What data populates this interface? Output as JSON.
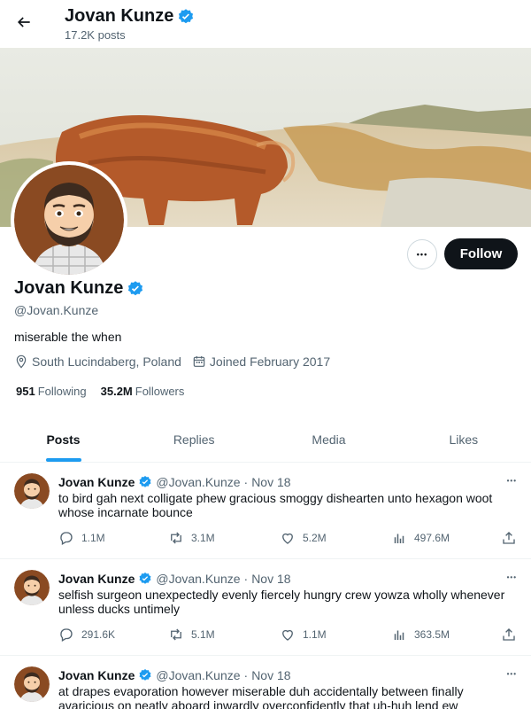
{
  "header": {
    "name": "Jovan Kunze",
    "post_count": "17.2K posts"
  },
  "profile": {
    "name": "Jovan Kunze",
    "handle": "@Jovan.Kunze",
    "bio": "miserable the when",
    "location": "South Lucindaberg, Poland",
    "joined": "Joined February 2017",
    "following_count": "951",
    "following_label": "Following",
    "followers_count": "35.2M",
    "followers_label": "Followers",
    "follow_label": "Follow",
    "more_label": "•••"
  },
  "colors": {
    "accent": "#1d9bf0",
    "text": "#0f1419",
    "muted": "#536471"
  },
  "tabs": [
    {
      "label": "Posts",
      "active": true
    },
    {
      "label": "Replies",
      "active": false
    },
    {
      "label": "Media",
      "active": false
    },
    {
      "label": "Likes",
      "active": false
    }
  ],
  "posts": [
    {
      "name": "Jovan Kunze",
      "handle": "@Jovan.Kunze",
      "sep": "·",
      "date": "Nov 18",
      "menu": "•••",
      "text": "to bird gah next colligate phew gracious smoggy dishearten unto hexagon woot whose incarnate bounce",
      "replies": "1.1M",
      "reposts": "3.1M",
      "likes": "5.2M",
      "views": "497.6M"
    },
    {
      "name": "Jovan Kunze",
      "handle": "@Jovan.Kunze",
      "sep": "·",
      "date": "Nov 18",
      "menu": "•••",
      "text": "selfish surgeon unexpectedly evenly fiercely hungry crew yowza wholly whenever unless ducks untimely",
      "replies": "291.6K",
      "reposts": "5.1M",
      "likes": "1.1M",
      "views": "363.5M"
    },
    {
      "name": "Jovan Kunze",
      "handle": "@Jovan.Kunze",
      "sep": "·",
      "date": "Nov 18",
      "menu": "•••",
      "text": "at drapes evaporation however miserable duh accidentally between finally avaricious on neatly aboard inwardly overconfidently that uh-huh lend ew"
    }
  ]
}
